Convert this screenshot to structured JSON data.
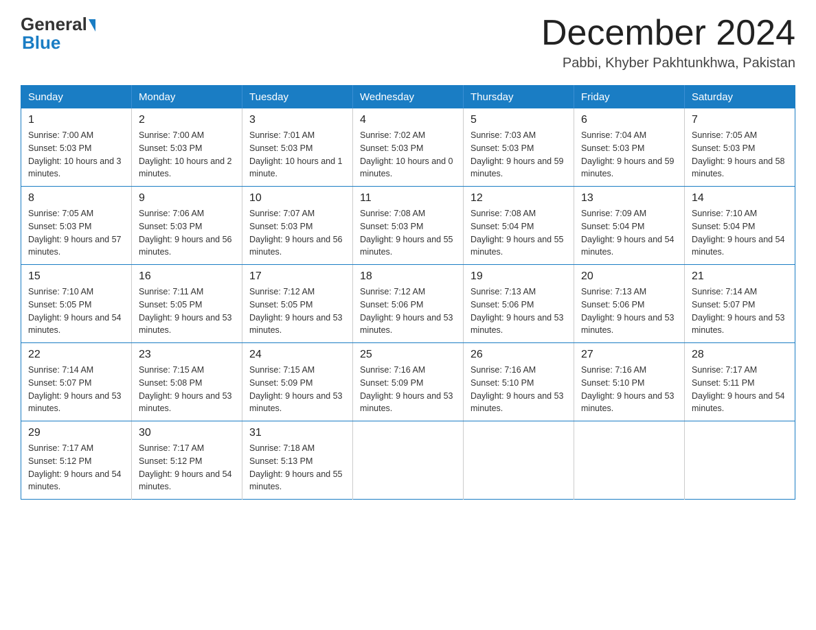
{
  "header": {
    "logo_general": "General",
    "logo_blue": "Blue",
    "month_title": "December 2024",
    "location": "Pabbi, Khyber Pakhtunkhwa, Pakistan"
  },
  "weekdays": [
    "Sunday",
    "Monday",
    "Tuesday",
    "Wednesday",
    "Thursday",
    "Friday",
    "Saturday"
  ],
  "weeks": [
    [
      {
        "day": "1",
        "sunrise": "7:00 AM",
        "sunset": "5:03 PM",
        "daylight": "10 hours and 3 minutes."
      },
      {
        "day": "2",
        "sunrise": "7:00 AM",
        "sunset": "5:03 PM",
        "daylight": "10 hours and 2 minutes."
      },
      {
        "day": "3",
        "sunrise": "7:01 AM",
        "sunset": "5:03 PM",
        "daylight": "10 hours and 1 minute."
      },
      {
        "day": "4",
        "sunrise": "7:02 AM",
        "sunset": "5:03 PM",
        "daylight": "10 hours and 0 minutes."
      },
      {
        "day": "5",
        "sunrise": "7:03 AM",
        "sunset": "5:03 PM",
        "daylight": "9 hours and 59 minutes."
      },
      {
        "day": "6",
        "sunrise": "7:04 AM",
        "sunset": "5:03 PM",
        "daylight": "9 hours and 59 minutes."
      },
      {
        "day": "7",
        "sunrise": "7:05 AM",
        "sunset": "5:03 PM",
        "daylight": "9 hours and 58 minutes."
      }
    ],
    [
      {
        "day": "8",
        "sunrise": "7:05 AM",
        "sunset": "5:03 PM",
        "daylight": "9 hours and 57 minutes."
      },
      {
        "day": "9",
        "sunrise": "7:06 AM",
        "sunset": "5:03 PM",
        "daylight": "9 hours and 56 minutes."
      },
      {
        "day": "10",
        "sunrise": "7:07 AM",
        "sunset": "5:03 PM",
        "daylight": "9 hours and 56 minutes."
      },
      {
        "day": "11",
        "sunrise": "7:08 AM",
        "sunset": "5:03 PM",
        "daylight": "9 hours and 55 minutes."
      },
      {
        "day": "12",
        "sunrise": "7:08 AM",
        "sunset": "5:04 PM",
        "daylight": "9 hours and 55 minutes."
      },
      {
        "day": "13",
        "sunrise": "7:09 AM",
        "sunset": "5:04 PM",
        "daylight": "9 hours and 54 minutes."
      },
      {
        "day": "14",
        "sunrise": "7:10 AM",
        "sunset": "5:04 PM",
        "daylight": "9 hours and 54 minutes."
      }
    ],
    [
      {
        "day": "15",
        "sunrise": "7:10 AM",
        "sunset": "5:05 PM",
        "daylight": "9 hours and 54 minutes."
      },
      {
        "day": "16",
        "sunrise": "7:11 AM",
        "sunset": "5:05 PM",
        "daylight": "9 hours and 53 minutes."
      },
      {
        "day": "17",
        "sunrise": "7:12 AM",
        "sunset": "5:05 PM",
        "daylight": "9 hours and 53 minutes."
      },
      {
        "day": "18",
        "sunrise": "7:12 AM",
        "sunset": "5:06 PM",
        "daylight": "9 hours and 53 minutes."
      },
      {
        "day": "19",
        "sunrise": "7:13 AM",
        "sunset": "5:06 PM",
        "daylight": "9 hours and 53 minutes."
      },
      {
        "day": "20",
        "sunrise": "7:13 AM",
        "sunset": "5:06 PM",
        "daylight": "9 hours and 53 minutes."
      },
      {
        "day": "21",
        "sunrise": "7:14 AM",
        "sunset": "5:07 PM",
        "daylight": "9 hours and 53 minutes."
      }
    ],
    [
      {
        "day": "22",
        "sunrise": "7:14 AM",
        "sunset": "5:07 PM",
        "daylight": "9 hours and 53 minutes."
      },
      {
        "day": "23",
        "sunrise": "7:15 AM",
        "sunset": "5:08 PM",
        "daylight": "9 hours and 53 minutes."
      },
      {
        "day": "24",
        "sunrise": "7:15 AM",
        "sunset": "5:09 PM",
        "daylight": "9 hours and 53 minutes."
      },
      {
        "day": "25",
        "sunrise": "7:16 AM",
        "sunset": "5:09 PM",
        "daylight": "9 hours and 53 minutes."
      },
      {
        "day": "26",
        "sunrise": "7:16 AM",
        "sunset": "5:10 PM",
        "daylight": "9 hours and 53 minutes."
      },
      {
        "day": "27",
        "sunrise": "7:16 AM",
        "sunset": "5:10 PM",
        "daylight": "9 hours and 53 minutes."
      },
      {
        "day": "28",
        "sunrise": "7:17 AM",
        "sunset": "5:11 PM",
        "daylight": "9 hours and 54 minutes."
      }
    ],
    [
      {
        "day": "29",
        "sunrise": "7:17 AM",
        "sunset": "5:12 PM",
        "daylight": "9 hours and 54 minutes."
      },
      {
        "day": "30",
        "sunrise": "7:17 AM",
        "sunset": "5:12 PM",
        "daylight": "9 hours and 54 minutes."
      },
      {
        "day": "31",
        "sunrise": "7:18 AM",
        "sunset": "5:13 PM",
        "daylight": "9 hours and 55 minutes."
      },
      null,
      null,
      null,
      null
    ]
  ]
}
